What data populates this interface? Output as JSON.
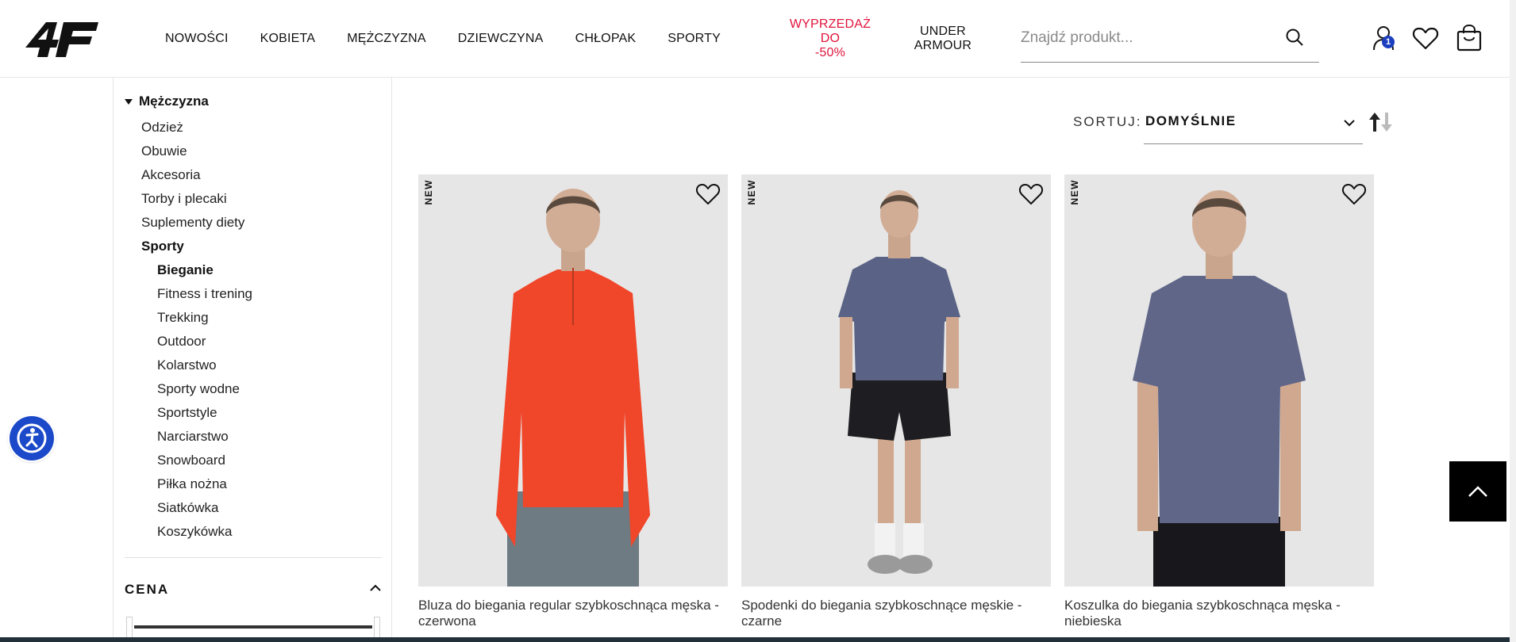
{
  "header": {
    "logo_text": "4F",
    "nav": [
      "NOWOŚCI",
      "KOBIETA",
      "MĘŻCZYZNA",
      "DZIEWCZYNA",
      "CHŁOPAK",
      "SPORTY"
    ],
    "sale_line1": "WYPRZEDAŻ DO",
    "sale_line2": "-50%",
    "ua_line1": "UNDER",
    "ua_line2": "ARMOUR",
    "search_placeholder": "Znajdź produkt...",
    "user_badge_count": "1",
    "sale_color": "#e0143c",
    "badge_color": "#1c3fbf"
  },
  "sidebar": {
    "root": "Mężczyzna",
    "categories": [
      {
        "label": "Odzież",
        "level": 1,
        "bold": false
      },
      {
        "label": "Obuwie",
        "level": 1,
        "bold": false
      },
      {
        "label": "Akcesoria",
        "level": 1,
        "bold": false
      },
      {
        "label": "Torby i plecaki",
        "level": 1,
        "bold": false
      },
      {
        "label": "Suplementy diety",
        "level": 1,
        "bold": false
      },
      {
        "label": "Sporty",
        "level": 1,
        "bold": true
      },
      {
        "label": "Bieganie",
        "level": 2,
        "bold": true
      },
      {
        "label": "Fitness i trening",
        "level": 2,
        "bold": false
      },
      {
        "label": "Trekking",
        "level": 2,
        "bold": false
      },
      {
        "label": "Outdoor",
        "level": 2,
        "bold": false
      },
      {
        "label": "Kolarstwo",
        "level": 2,
        "bold": false
      },
      {
        "label": "Sporty wodne",
        "level": 2,
        "bold": false
      },
      {
        "label": "Sportstyle",
        "level": 2,
        "bold": false
      },
      {
        "label": "Narciarstwo",
        "level": 2,
        "bold": false
      },
      {
        "label": "Snowboard",
        "level": 2,
        "bold": false
      },
      {
        "label": "Piłka nożna",
        "level": 2,
        "bold": false
      },
      {
        "label": "Siatkówka",
        "level": 2,
        "bold": false
      },
      {
        "label": "Koszykówka",
        "level": 2,
        "bold": false
      }
    ],
    "price_filter_title": "CENA"
  },
  "sort": {
    "label": "SORTUJ:",
    "value": "DOMYŚLNIE"
  },
  "products": [
    {
      "badge": "NEW",
      "name": "Bluza do biegania regular szybkoschnąca męska - czerwona",
      "top_color": "#f0462a",
      "bottom_color": "#6e7b82"
    },
    {
      "badge": "NEW",
      "name": "Spodenki do biegania szybkoschnące męskie - czarne",
      "top_color": "#5a6385",
      "bottom_color": "#1e1e22"
    },
    {
      "badge": "NEW",
      "name": "Koszulka do biegania szybkoschnąca męska - niebieska",
      "top_color": "#5f6688",
      "bottom_color": "#18181c"
    }
  ],
  "icons": {
    "search": "search-icon",
    "user": "user-icon",
    "wishlist": "heart-icon",
    "cart": "shopping-bag-icon",
    "accessibility": "accessibility-icon",
    "back_to_top": "chevron-up-icon"
  }
}
